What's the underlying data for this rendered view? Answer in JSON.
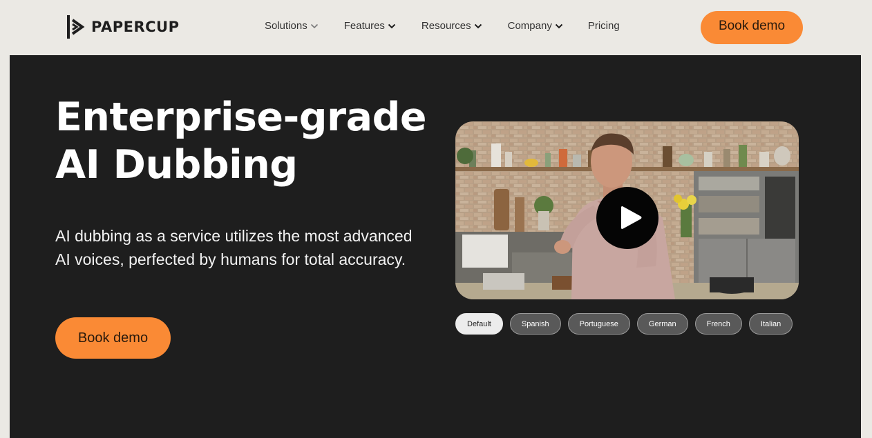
{
  "brand": {
    "name": "PAPERCUP"
  },
  "nav": {
    "items": [
      {
        "label": "Solutions",
        "has_dropdown": true
      },
      {
        "label": "Features",
        "has_dropdown": true
      },
      {
        "label": "Resources",
        "has_dropdown": true
      },
      {
        "label": "Company",
        "has_dropdown": true
      },
      {
        "label": "Pricing",
        "has_dropdown": false
      }
    ],
    "cta_label": "Book demo"
  },
  "hero": {
    "title_line1": "Enterprise-grade",
    "title_line2": "AI Dubbing",
    "subtitle": "AI dubbing as a service utilizes the most advanced AI voices, perfected by humans for total accuracy.",
    "cta_label": "Book demo"
  },
  "video": {
    "play_icon": "play-icon",
    "languages": [
      {
        "label": "Default",
        "active": true
      },
      {
        "label": "Spanish",
        "active": false
      },
      {
        "label": "Portuguese",
        "active": false
      },
      {
        "label": "German",
        "active": false
      },
      {
        "label": "French",
        "active": false
      },
      {
        "label": "Italian",
        "active": false
      }
    ]
  },
  "colors": {
    "accent": "#fa8a35",
    "page_bg": "#ebe9e4",
    "hero_bg": "#1e1e1e",
    "pill_bg": "#595959",
    "pill_active_bg": "#ececec"
  }
}
